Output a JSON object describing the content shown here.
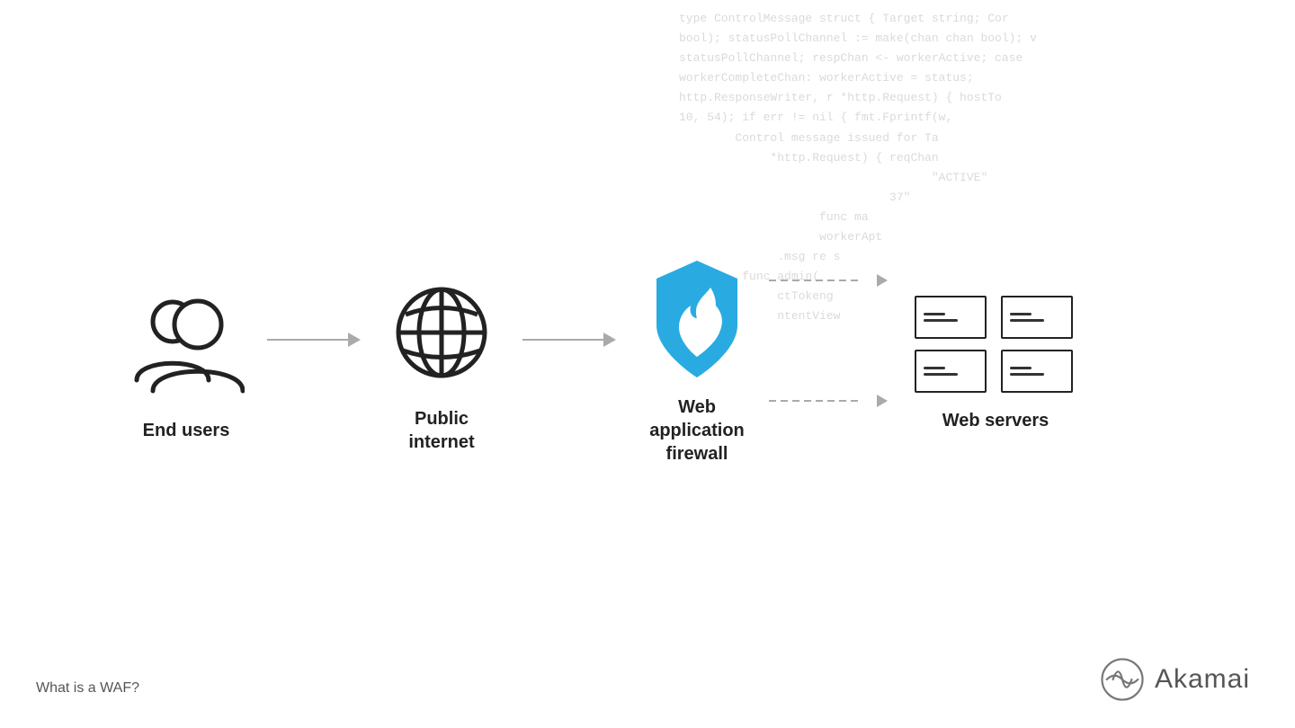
{
  "code_bg": {
    "lines": [
      "type ControlMessage struct { Target string; Cor",
      "bool); statusPollChannel := make(chan chan bool); v",
      "statusPollChannel; respChan <- workerActive; case",
      "workerCompleteChan: workerActive = status;",
      "http.ResponseWriter, r *http.Request) { hostTo",
      "10, 54); if err != nil { fmt.Fprintf(w,",
      "Control message issued for Ta",
      "*http.Request) { reqChan",
      "\"ACTIVE\"",
      "37\"",
      "func ma",
      "workerApt",
      ".msg re s",
      "func admin(",
      "ctTokeng",
      "ntentView"
    ]
  },
  "diagram": {
    "nodes": [
      {
        "id": "end-users",
        "label": "End users"
      },
      {
        "id": "public-internet",
        "label": "Public\ninternet"
      },
      {
        "id": "waf",
        "label": "Web application\nfirewall"
      },
      {
        "id": "web-servers",
        "label": "Web servers"
      }
    ],
    "arrows": [
      {
        "type": "solid",
        "from": "end-users",
        "to": "public-internet"
      },
      {
        "type": "solid",
        "from": "public-internet",
        "to": "waf"
      },
      {
        "type": "dashed",
        "from": "waf",
        "to": "web-servers"
      }
    ]
  },
  "bottom_label": "What is a WAF?",
  "akamai": {
    "text": "Akamai"
  },
  "colors": {
    "accent_blue": "#29abe2",
    "icon_dark": "#222222",
    "arrow_color": "#aaaaaa",
    "label_color": "#222222"
  }
}
